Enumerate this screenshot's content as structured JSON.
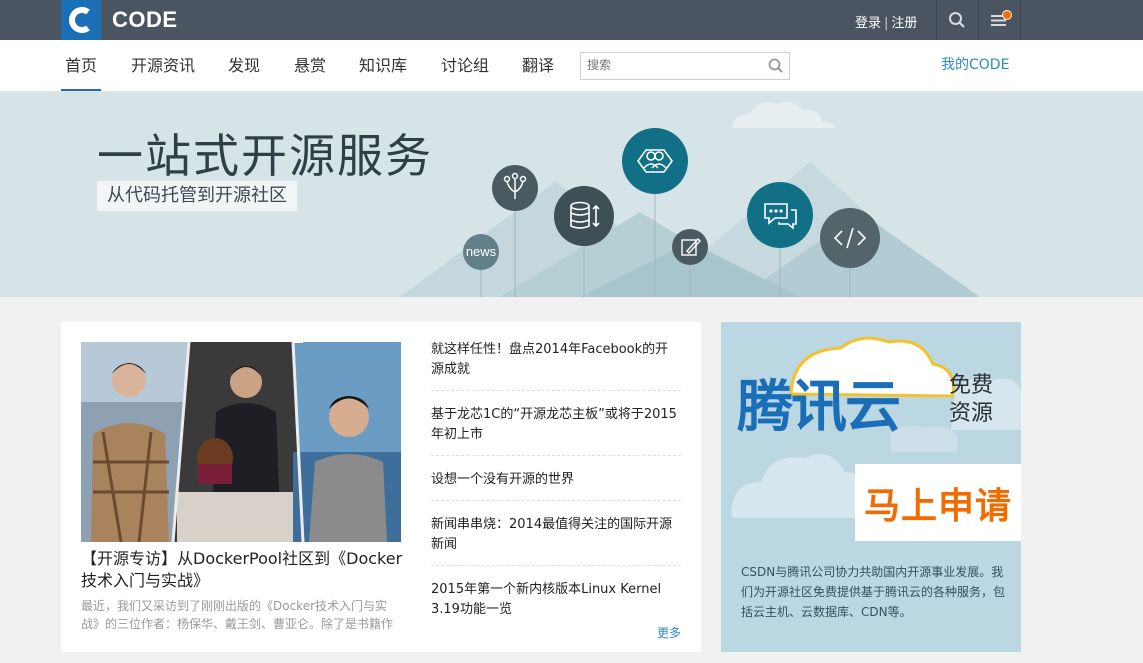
{
  "header": {
    "logo_letter": "C",
    "logo_text": "CODE",
    "login": "登录",
    "separator": "|",
    "register": "注册"
  },
  "nav": {
    "items": [
      "首页",
      "开源资讯",
      "发现",
      "悬赏",
      "知识库",
      "讨论组",
      "翻译"
    ],
    "active_index": 0,
    "search_placeholder": "搜索",
    "my_code": "我的CODE"
  },
  "banner": {
    "title": "一站式开源服务",
    "subtitle": "从代码托管到开源社区",
    "news_badge": "news"
  },
  "feature": {
    "title": "【开源专访】从DockerPool社区到《Docker技术入门与实战》",
    "excerpt": "最近，我们又采访到了刚刚出版的《Docker技术入门与实战》的三位作者：杨保华、戴王剑、曹亚仑。除了是书籍作"
  },
  "news": [
    "就这样任性！盘点2014年Facebook的开源成就",
    "基于龙芯1C的“开源龙芯主板”或将于2015年初上市",
    "设想一个没有开源的世界",
    "新闻串串烧：2014最值得关注的国际开源新闻",
    "2015年第一个新内核版本Linux Kernel 3.19功能一览"
  ],
  "more": "更多",
  "ad": {
    "brand": "腾讯云",
    "free_line1": "免费",
    "free_line2": "资源",
    "apply": "马上申请",
    "description": "CSDN与腾讯公司协力共助国内开源事业发展。我们为开源社区免费提供基于腾讯云的各种服务，包括云主机、云数据库、CDN等。"
  },
  "colors": {
    "topbar": "#4b5561",
    "brand_blue": "#1b6fb6",
    "teal": "#116d86",
    "slate": "#4a5a60",
    "link": "#2e8bc0",
    "orange": "#f06c00"
  }
}
